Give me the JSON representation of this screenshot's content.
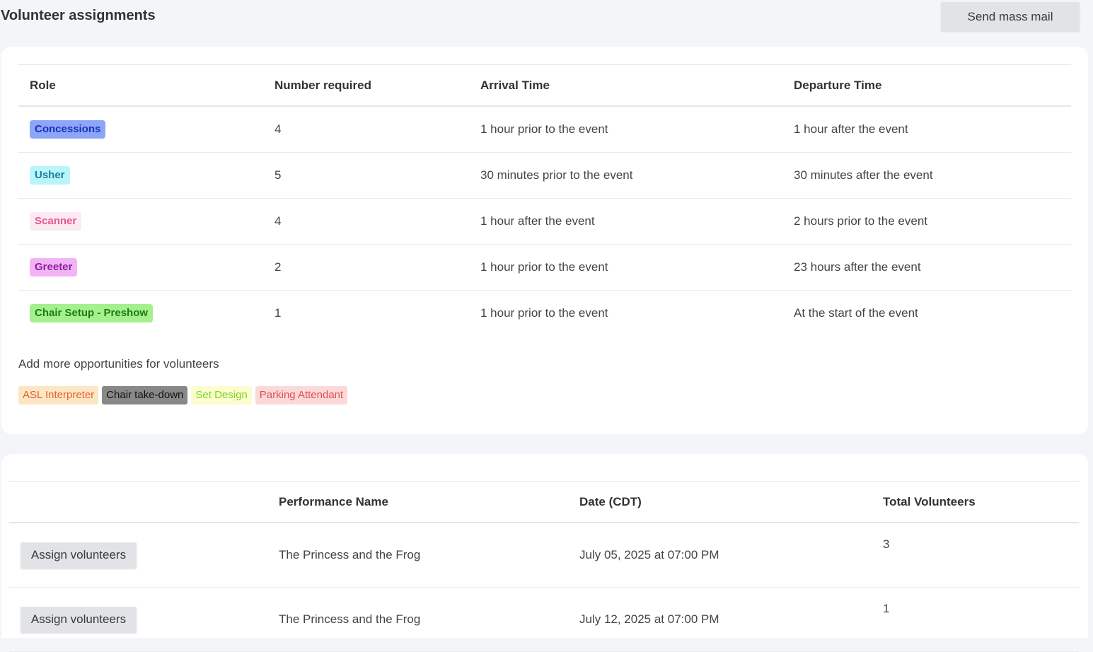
{
  "header": {
    "title": "Volunteer assignments",
    "mass_mail_label": "Send mass mail"
  },
  "roles_table": {
    "columns": [
      "Role",
      "Number required",
      "Arrival Time",
      "Departure Time"
    ],
    "rows": [
      {
        "role": "Concessions",
        "number": "4",
        "arrival": "1 hour prior to the event",
        "departure": "1 hour after the event",
        "tag_bg": "#8da6f7",
        "tag_fg": "#1a32b8"
      },
      {
        "role": "Usher",
        "number": "5",
        "arrival": "30 minutes prior to the event",
        "departure": "30 minutes after the event",
        "tag_bg": "#b9f6fb",
        "tag_fg": "#1a7e9a"
      },
      {
        "role": "Scanner",
        "number": "4",
        "arrival": "1 hour after the event",
        "departure": "2 hours prior to the event",
        "tag_bg": "#fde9f1",
        "tag_fg": "#e35a8c"
      },
      {
        "role": "Greeter",
        "number": "2",
        "arrival": "1 hour prior to the event",
        "departure": "23 hours after the event",
        "tag_bg": "#f3b4f6",
        "tag_fg": "#8a1e9c"
      },
      {
        "role": "Chair Setup - Preshow",
        "number": "1",
        "arrival": "1 hour prior to the event",
        "departure": "At the start of the event",
        "tag_bg": "#a3f08c",
        "tag_fg": "#1e7a17"
      }
    ]
  },
  "opportunities": {
    "label": "Add more opportunities for volunteers",
    "items": [
      {
        "label": "ASL Interpreter",
        "bg": "#fde6c4",
        "fg": "#e2632e"
      },
      {
        "label": "Chair take-down",
        "bg": "#888888",
        "fg": "#111111"
      },
      {
        "label": "Set Design",
        "bg": "#fbfdcf",
        "fg": "#7ed321"
      },
      {
        "label": "Parking Attendant",
        "bg": "#fcd9d9",
        "fg": "#e05050"
      }
    ]
  },
  "performances_table": {
    "columns": [
      "",
      "Performance Name",
      "Date (CDT)",
      "Total Volunteers"
    ],
    "assign_label": "Assign volunteers",
    "rows": [
      {
        "name": "The Princess and the Frog",
        "date": "July 05, 2025 at 07:00 PM",
        "total": "3"
      },
      {
        "name": "The Princess and the Frog",
        "date": "July 12, 2025 at 07:00 PM",
        "total": "1"
      }
    ]
  }
}
